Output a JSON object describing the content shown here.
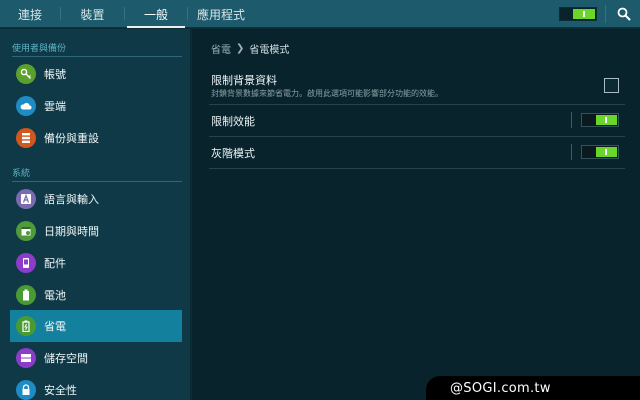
{
  "tabs": [
    {
      "label": "連接"
    },
    {
      "label": "裝置"
    },
    {
      "label": "一般",
      "selected": true
    },
    {
      "label": "應用程式"
    }
  ],
  "header": {
    "master_switch_on": true,
    "search_icon": "search-icon"
  },
  "sidebar": {
    "sections": [
      {
        "title": "使用者與備份"
      },
      {
        "title": "系統"
      }
    ],
    "items": [
      {
        "label": "帳號",
        "icon": "key-icon",
        "color": "#5aa02c"
      },
      {
        "label": "雲端",
        "icon": "cloud-icon",
        "color": "#1d8cc4"
      },
      {
        "label": "備份與重設",
        "icon": "backup-icon",
        "color": "#d2571f"
      },
      {
        "label": "語言與輸入",
        "icon": "language-icon",
        "color": "#7a6bb0"
      },
      {
        "label": "日期與時間",
        "icon": "calendar-icon",
        "color": "#4f9a3a"
      },
      {
        "label": "配件",
        "icon": "accessory-icon",
        "color": "#8c3cc8"
      },
      {
        "label": "電池",
        "icon": "battery-icon",
        "color": "#4a9a34"
      },
      {
        "label": "省電",
        "icon": "power-saving-icon",
        "color": "#4a9a34",
        "selected": true
      },
      {
        "label": "儲存空間",
        "icon": "storage-icon",
        "color": "#8c3cc8"
      },
      {
        "label": "安全性",
        "icon": "lock-icon",
        "color": "#1d8cc4"
      }
    ]
  },
  "breadcrumb": {
    "parent": "省電",
    "current": "省電模式"
  },
  "settings": [
    {
      "title": "限制背景資料",
      "description": "封鎖背景數據來節省電力。啟用此選項可能影響部分功能的效能。",
      "control": "checkbox",
      "checked": false
    },
    {
      "title": "限制效能",
      "control": "toggle",
      "on": true
    },
    {
      "title": "灰階模式",
      "control": "toggle",
      "on": true
    }
  ],
  "watermark": "@SOGI.com.tw",
  "colors": {
    "topbar": "#1d5a6b",
    "sidebar": "#0f3947",
    "main_bg": "#08232b",
    "active_item": "#13809e",
    "toggle_on": "#6ad62a",
    "section_header": "#5fb3c7"
  }
}
